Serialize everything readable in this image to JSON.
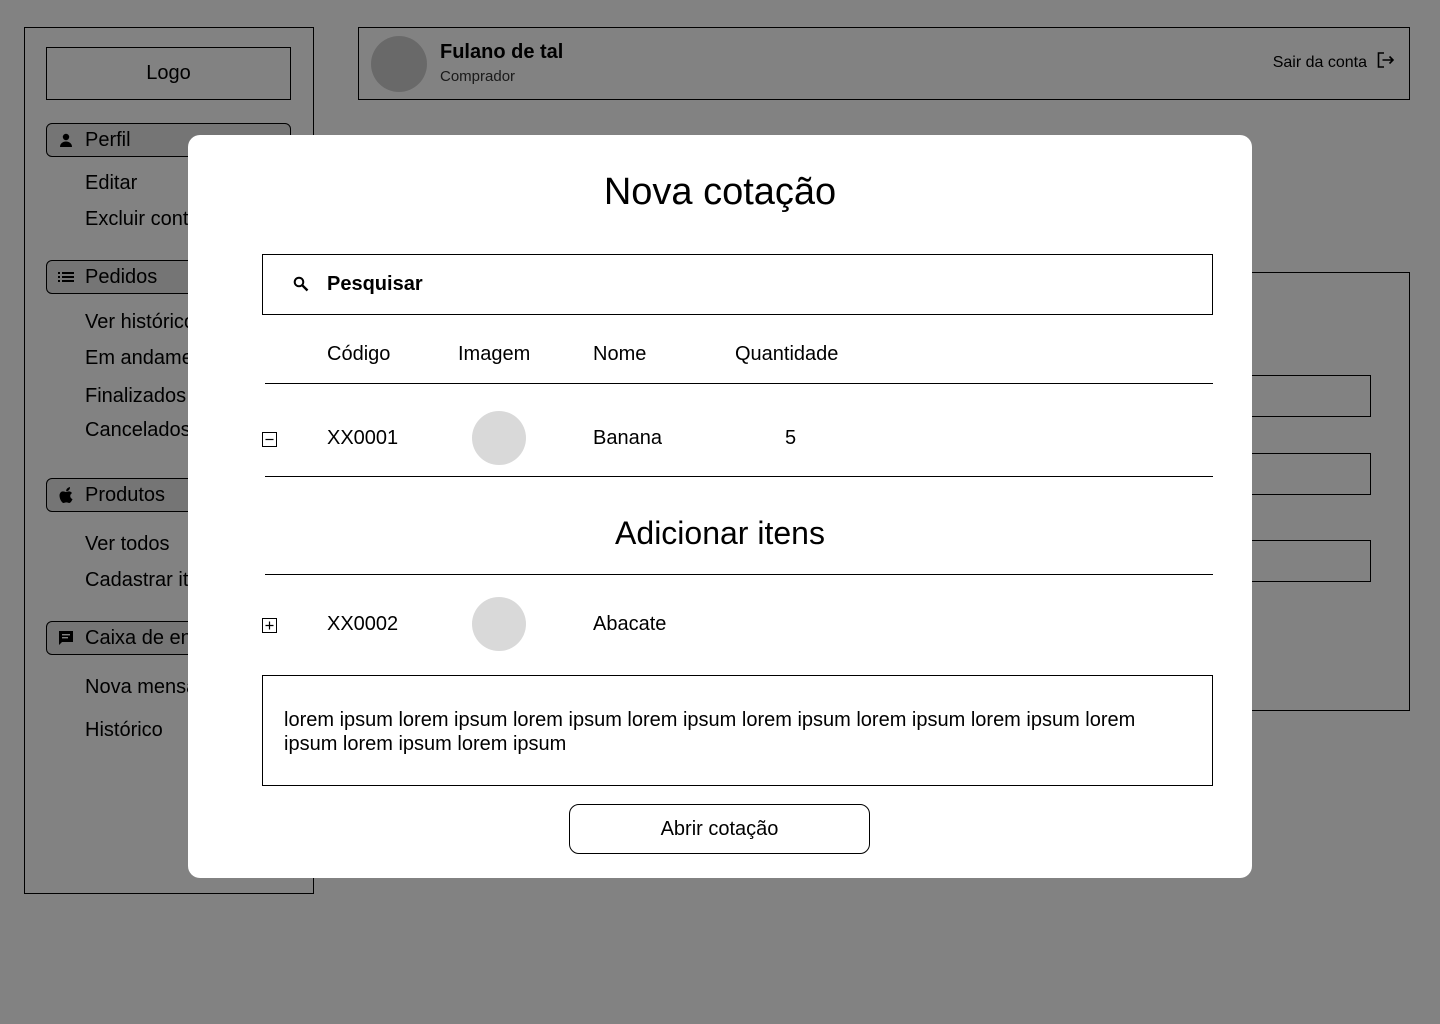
{
  "sidebar": {
    "logo": "Logo",
    "sections": [
      {
        "icon": "person-icon",
        "label": "Perfil",
        "items": [
          "Editar",
          "Excluir conta"
        ]
      },
      {
        "icon": "list-icon",
        "label": "Pedidos",
        "items": [
          "Ver histórico",
          "Em andamento",
          "Finalizados",
          "Cancelados"
        ]
      },
      {
        "icon": "apple-icon",
        "label": "Produtos",
        "items": [
          "Ver todos",
          "Cadastrar item"
        ]
      },
      {
        "icon": "chat-icon",
        "label": "Caixa de entrada",
        "items": [
          "Nova mensagem",
          "Histórico"
        ]
      }
    ]
  },
  "header": {
    "user_name": "Fulano de tal",
    "user_role": "Comprador",
    "logout_label": "Sair da conta"
  },
  "modal": {
    "title": "Nova cotação",
    "search_placeholder": "Pesquisar",
    "columns": [
      "Código",
      "Imagem",
      "Nome",
      "Quantidade"
    ],
    "selected_items": [
      {
        "code": "XX0001",
        "name": "Banana",
        "quantity": "5"
      }
    ],
    "add_section_title": "Adicionar itens",
    "available_items": [
      {
        "code": "XX0002",
        "name": "Abacate"
      }
    ],
    "notes_text": "lorem ipsum lorem ipsum lorem ipsum lorem ipsum lorem ipsum lorem ipsum lorem ipsum lorem ipsum lorem ipsum lorem ipsum",
    "submit_label": "Abrir cotação"
  }
}
